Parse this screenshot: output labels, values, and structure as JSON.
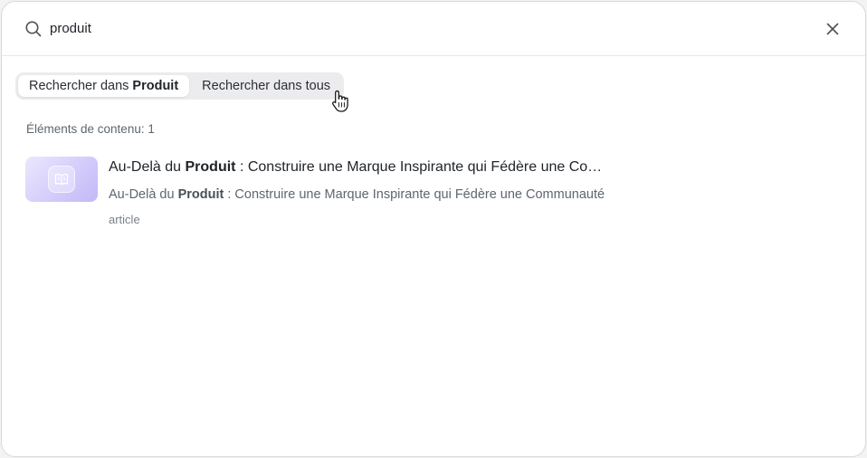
{
  "search": {
    "value": "produit",
    "placeholder": ""
  },
  "scope": {
    "options": [
      {
        "prefix": "Rechercher dans",
        "bold": "Produit",
        "active": true
      },
      {
        "prefix": "Rechercher dans tous",
        "bold": "",
        "active": false
      }
    ]
  },
  "results": {
    "count_label": "Éléments de contenu: 1",
    "items": [
      {
        "title_prefix": "Au-Delà du ",
        "title_match": "Produit",
        "title_suffix": " : Construire une Marque Inspirante qui Fédère une Co…",
        "desc_prefix": "Au-Delà du ",
        "desc_match": "Produit",
        "desc_suffix": " : Construire une Marque Inspirante qui Fédère une Communauté",
        "type": "article",
        "icon": "book-icon"
      }
    ]
  },
  "icons": {
    "search": "search-icon",
    "close": "close-icon",
    "cursor": "hand-pointer-icon"
  },
  "colors": {
    "thumb_gradient_start": "#ece8fd",
    "thumb_gradient_end": "#c3b8f7",
    "text_primary": "#1f2328",
    "text_secondary": "#5f6570"
  }
}
